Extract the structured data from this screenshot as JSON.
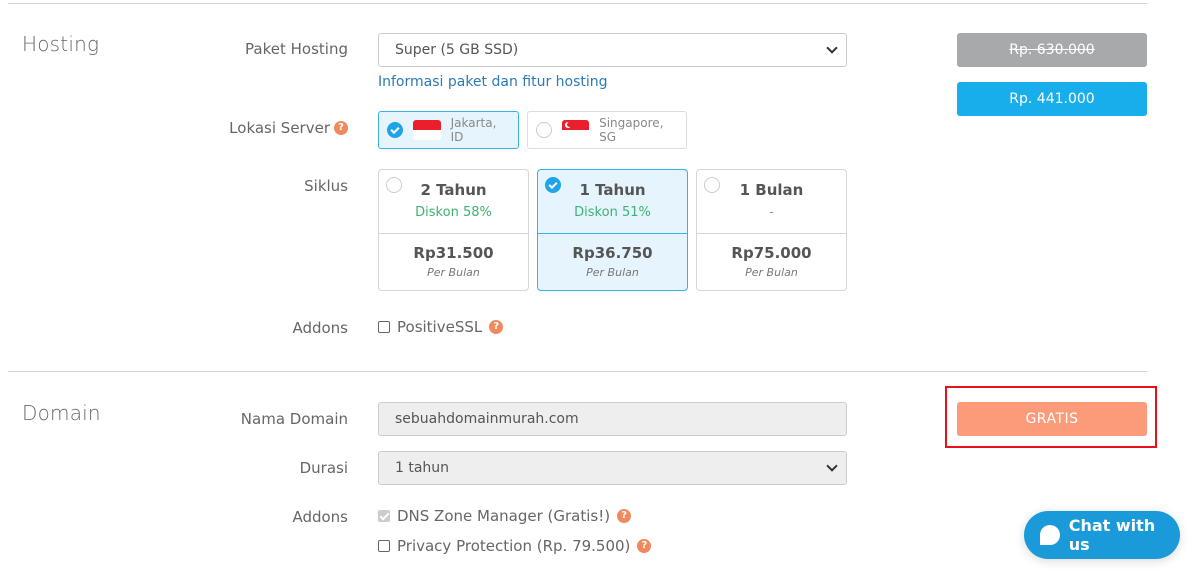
{
  "hosting": {
    "section_title": "Hosting",
    "package": {
      "label": "Paket Hosting",
      "selected": "Super (5 GB SSD)",
      "info_link": "Informasi paket dan fitur hosting"
    },
    "server_location": {
      "label": "Lokasi Server",
      "help_icon": "question-circle-icon",
      "options": [
        {
          "name": "Jakarta, ID",
          "flag": "flag-indonesia",
          "selected": true
        },
        {
          "name": "Singapore, SG",
          "flag": "flag-singapore",
          "selected": false
        }
      ]
    },
    "cycle": {
      "label": "Siklus",
      "options": [
        {
          "term": "2 Tahun",
          "discount": "Diskon 58%",
          "price": "Rp31.500",
          "per": "Per Bulan",
          "selected": false
        },
        {
          "term": "1 Tahun",
          "discount": "Diskon 51%",
          "price": "Rp36.750",
          "per": "Per Bulan",
          "selected": true
        },
        {
          "term": "1 Bulan",
          "discount": "-",
          "price": "Rp75.000",
          "per": "Per Bulan",
          "selected": false
        }
      ]
    },
    "addons": {
      "label": "Addons",
      "items": [
        {
          "label": "PositiveSSL",
          "checked": false
        }
      ]
    },
    "price_original": "Rp. 630.000",
    "price_final": "Rp. 441.000"
  },
  "domain": {
    "section_title": "Domain",
    "name": {
      "label": "Nama Domain",
      "value": "sebuahdomainmurah.com"
    },
    "duration": {
      "label": "Durasi",
      "selected": "1 tahun"
    },
    "addons": {
      "label": "Addons",
      "items": [
        {
          "label": "DNS Zone Manager (Gratis!)",
          "checked": true,
          "disabled": true
        },
        {
          "label": "Privacy Protection (Rp. 79.500)",
          "checked": false,
          "disabled": false
        }
      ]
    },
    "price": "GRATIS"
  },
  "chat": {
    "label": "Chat with us"
  },
  "colors": {
    "accent_blue": "#18aeec",
    "discount_green": "#3cb371",
    "help_orange": "#f08a5d",
    "free_salmon": "#fc9b7a",
    "highlight_red": "#e8101a"
  }
}
